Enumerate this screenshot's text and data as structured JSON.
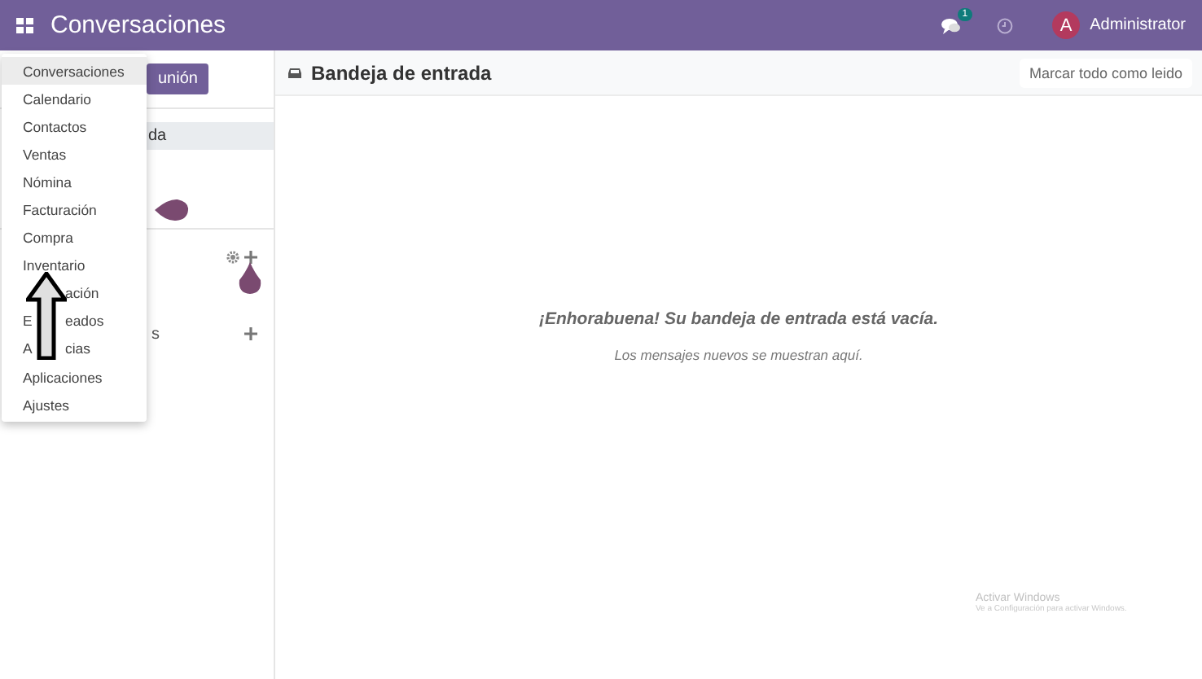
{
  "topbar": {
    "title": "Conversaciones",
    "chat_badge": "1",
    "user_initial": "A",
    "user_name": "Administrator"
  },
  "app_menu": {
    "items": [
      {
        "label": "Conversaciones",
        "selected": true
      },
      {
        "label": "Calendario",
        "selected": false
      },
      {
        "label": "Contactos",
        "selected": false
      },
      {
        "label": "Ventas",
        "selected": false
      },
      {
        "label": "Nómina",
        "selected": false
      },
      {
        "label": "Facturación",
        "selected": false
      },
      {
        "label": "Compra",
        "selected": false
      },
      {
        "label": "Inventario",
        "selected": false
      },
      {
        "kind": "covered",
        "visible_end": "ación",
        "selected": false
      },
      {
        "kind": "covered",
        "visible_start": "E",
        "visible_end": "eados",
        "selected": false
      },
      {
        "kind": "covered",
        "visible_start": "A",
        "visible_end": "cias",
        "selected": false
      },
      {
        "label": "Aplicaciones",
        "selected": false
      },
      {
        "label": "Ajustes",
        "selected": false
      }
    ]
  },
  "sidebar": {
    "button": "unión",
    "inbox_item": {
      "label": "da",
      "selected": true
    },
    "section_label": "s"
  },
  "content": {
    "title": "Bandeja de entrada",
    "mark_all_read": "Marcar todo como leido",
    "empty_title": "¡Enhorabuena! Su bandeja de entrada está vacía.",
    "empty_subtitle": "Los mensajes nuevos se muestran aquí."
  },
  "watermark": {
    "title": "Activar Windows",
    "subtitle": "Ve a Configuración para activar Windows."
  }
}
